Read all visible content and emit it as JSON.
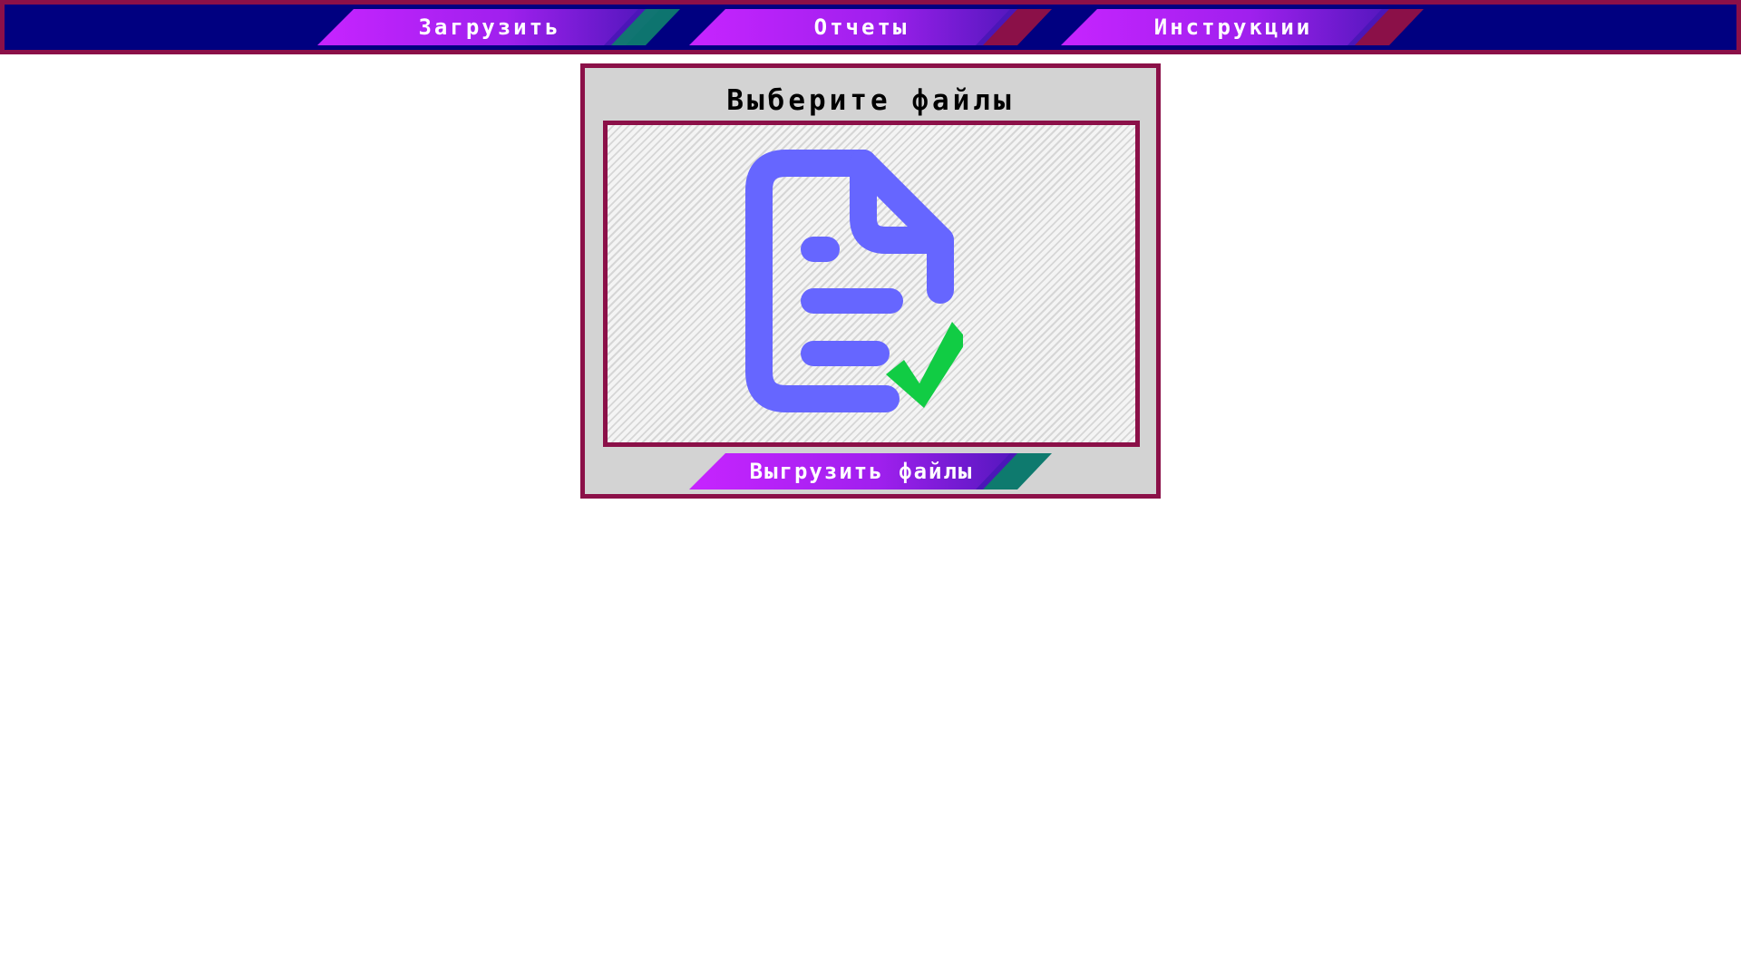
{
  "nav": {
    "items": [
      {
        "label": "Загрузить",
        "accent": "#0e7a6e"
      },
      {
        "label": "Отчеты",
        "accent": "#8b1048"
      },
      {
        "label": "Инструкции",
        "accent": "#8b1048"
      }
    ]
  },
  "upload_panel": {
    "title": "Выберите файлы",
    "icon": "file-check-icon",
    "button_label": "Выгрузить файлы",
    "button_accent": "#0e7a6e"
  },
  "colors": {
    "navbar_bg": "#000080",
    "border": "#8b1048",
    "button_gradient_start": "#c724ff",
    "button_gradient_end": "#4b16b8",
    "icon": "#6666ff",
    "check": "#11cc44",
    "panel_bg": "#d3d3d3"
  }
}
